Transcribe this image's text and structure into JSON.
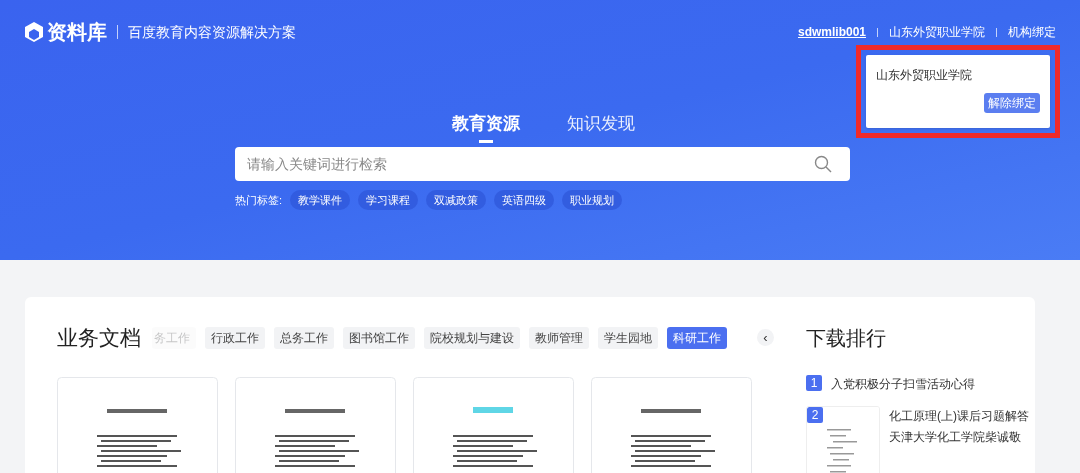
{
  "header": {
    "logo": "资料库",
    "tagline": "百度教育内容资源解决方案",
    "user_links": [
      {
        "label": "sdwmlib001",
        "kind": "account"
      },
      {
        "label": "山东外贸职业学院",
        "kind": "plain"
      },
      {
        "label": "机构绑定",
        "kind": "plain"
      }
    ]
  },
  "binding_popup": {
    "institution": "山东外贸职业学院",
    "button": "解除绑定",
    "highlighted": true
  },
  "nav_tabs": [
    {
      "label": "教育资源",
      "selected": true
    },
    {
      "label": "知识发现",
      "selected": false
    }
  ],
  "search": {
    "placeholder": "请输入关键词进行检索"
  },
  "hot_tags": {
    "label": "热门标签:",
    "tags": [
      "教学课件",
      "学习课程",
      "双减政策",
      "英语四级",
      "职业规划"
    ]
  },
  "documents": {
    "title": "业务文档",
    "categories": [
      {
        "label": "务工作",
        "selected": false,
        "faded": true
      },
      {
        "label": "行政工作",
        "selected": false,
        "faded": false
      },
      {
        "label": "总务工作",
        "selected": false,
        "faded": false
      },
      {
        "label": "图书馆工作",
        "selected": false,
        "faded": false
      },
      {
        "label": "院校规划与建设",
        "selected": false,
        "faded": false
      },
      {
        "label": "教师管理",
        "selected": false,
        "faded": false
      },
      {
        "label": "学生园地",
        "selected": false,
        "faded": false
      },
      {
        "label": "科研工作",
        "selected": true,
        "faded": false
      }
    ],
    "prev_button": "‹"
  },
  "download_ranking": {
    "title": "下载排行",
    "items": [
      {
        "rank": "1",
        "title": "入党积极分子扫雪活动心得",
        "thumbnail": false
      },
      {
        "rank": "2",
        "title": "化工原理(上)课后习题解答天津大学化工学院柴诚敬",
        "thumbnail": true
      }
    ]
  }
}
